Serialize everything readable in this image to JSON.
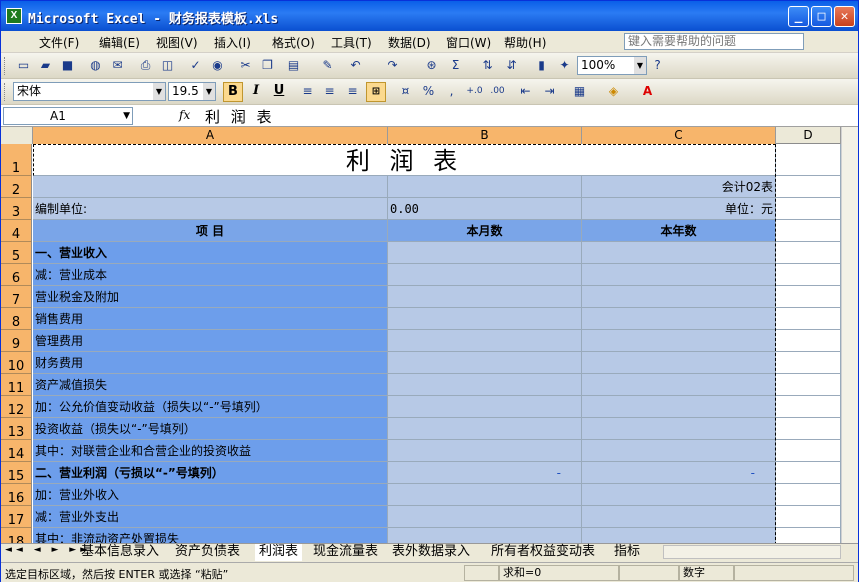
{
  "window": {
    "title": "Microsoft Excel - 财务报表模板.xls",
    "app_icon": "X",
    "buttons": [
      "_",
      "□",
      "✕"
    ]
  },
  "menu": {
    "items": [
      "文件(F)",
      "编辑(E)",
      "视图(V)",
      "插入(I)",
      "格式(O)",
      "工具(T)",
      "数据(D)",
      "窗口(W)",
      "帮助(H)"
    ],
    "help_placeholder": "键入需要帮助的问题"
  },
  "toolbar": {
    "zoom": "100%",
    "font": "宋体",
    "size": "19.5",
    "bold": "B",
    "italic": "I",
    "underline": "U",
    "percent": "%"
  },
  "formula": {
    "cell": "A1",
    "fx": "fx",
    "content": "利 润 表"
  },
  "columns": [
    "A",
    "B",
    "C",
    "D"
  ],
  "rows": [
    "1",
    "2",
    "3",
    "4",
    "5",
    "6",
    "7",
    "8",
    "9",
    "10",
    "11",
    "12",
    "13",
    "14",
    "15",
    "16",
    "17",
    "18"
  ],
  "sheet": {
    "title": "利 润 表",
    "r2c": "会计02表",
    "r3a": "编制单位:",
    "r3b": "0.00",
    "r3c": "单位：元",
    "h_item": "项  目",
    "h_month": "本月数",
    "h_year": "本年数",
    "items": [
      "一、营业收入",
      "减：营业成本",
      "营业税金及附加",
      "销售费用",
      "管理费用",
      "财务费用",
      "资产减值损失",
      "加：公允价值变动收益（损失以“-”号填列）",
      "投资收益（损失以“-”号填列）",
      "其中：对联营企业和合营企业的投资收益",
      "二、营业利润（亏损以“-”号填列）",
      "加：营业外收入",
      "减：营业外支出",
      "其中：非流动资产处置损失"
    ],
    "dash": "-"
  },
  "tabs": [
    "基本信息录入",
    "资产负债表",
    "利润表",
    "现金流量表",
    "表外数据录入",
    "所有者权益变动表",
    "指标"
  ],
  "status": {
    "left": "选定目标区域，然后按 ENTER 或选择 “粘贴”",
    "sum": "求和=0",
    "mode": "数字"
  }
}
